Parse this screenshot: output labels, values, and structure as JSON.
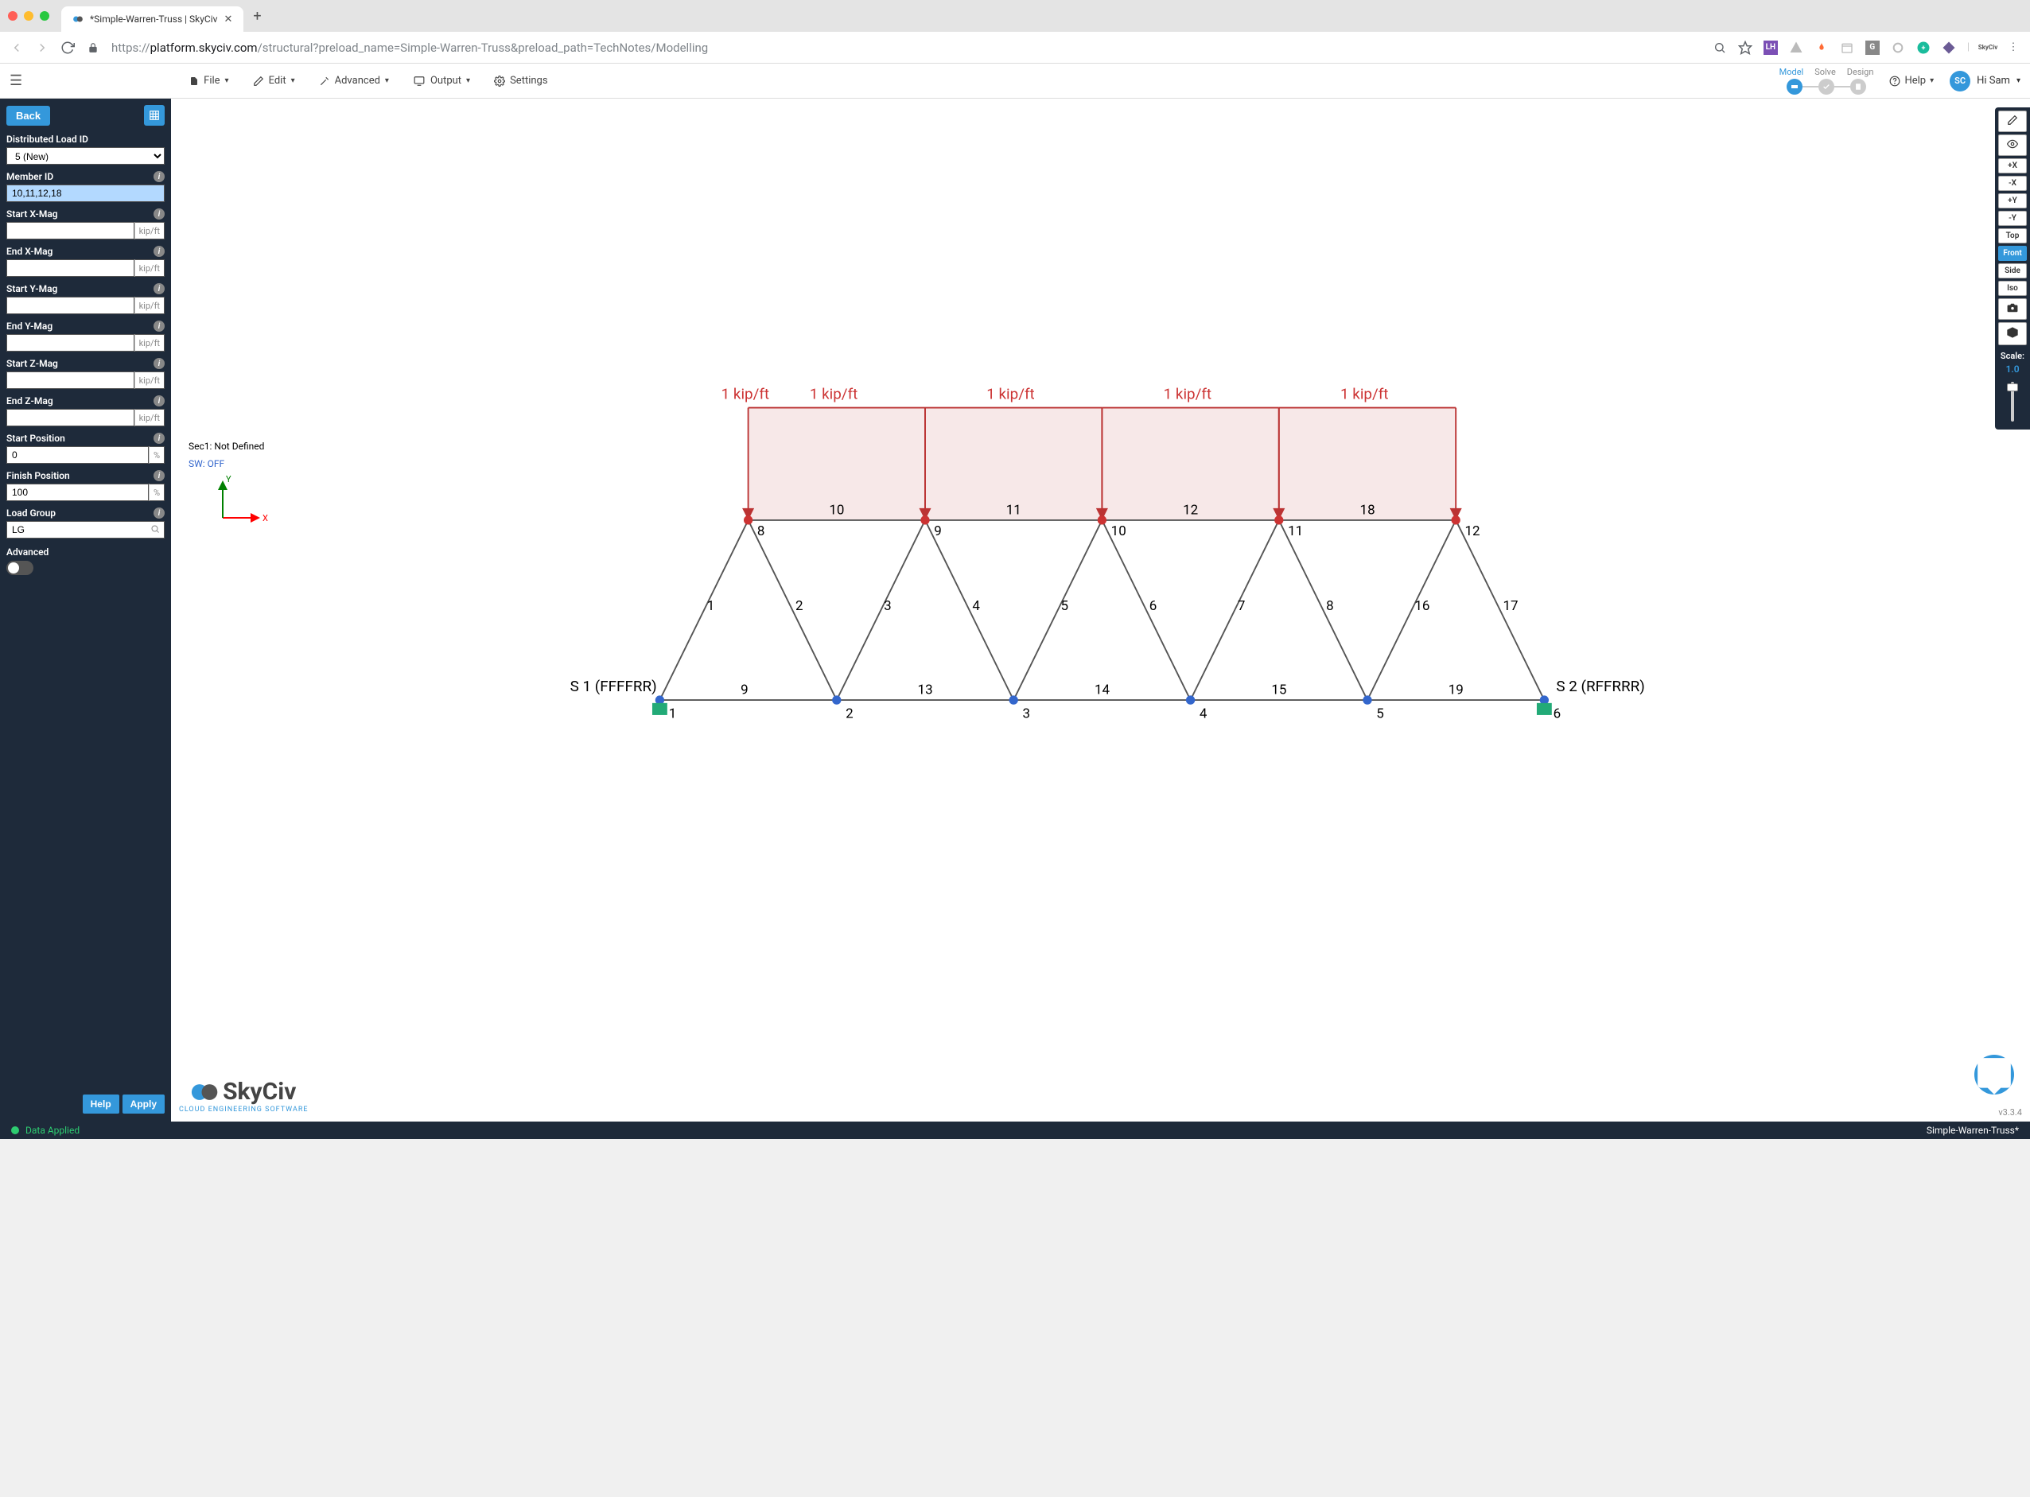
{
  "browser": {
    "tab_title": "*Simple-Warren-Truss | SkyCiv",
    "url_prefix": "https://",
    "url_host": "platform.skyciv.com",
    "url_path": "/structural?preload_name=Simple-Warren-Truss&preload_path=TechNotes/Modelling",
    "ext_lh": "LH",
    "ext_g": "G",
    "ext_skyciv": "SkyCiv"
  },
  "toolbar": {
    "file": "File",
    "edit": "Edit",
    "advanced": "Advanced",
    "output": "Output",
    "settings": "Settings",
    "workflow": {
      "model": "Model",
      "solve": "Solve",
      "design": "Design"
    },
    "help": "Help",
    "user_initials": "SC",
    "user_greeting": "Hi Sam"
  },
  "sidebar": {
    "back": "Back",
    "dl_id_label": "Distributed Load ID",
    "dl_id_value": "5 (New)",
    "member_id_label": "Member ID",
    "member_id_value": "10,11,12,18",
    "start_x_mag_label": "Start X-Mag",
    "start_x_mag_value": "",
    "end_x_mag_label": "End X-Mag",
    "end_x_mag_value": "",
    "start_y_mag_label": "Start Y-Mag",
    "start_y_mag_value": "",
    "end_y_mag_label": "End Y-Mag",
    "end_y_mag_value": "",
    "start_z_mag_label": "Start Z-Mag",
    "start_z_mag_value": "",
    "end_z_mag_label": "End Z-Mag",
    "end_z_mag_value": "",
    "unit_mag": "kip/ft",
    "start_pos_label": "Start Position",
    "start_pos_value": "0",
    "finish_pos_label": "Finish Position",
    "finish_pos_value": "100",
    "unit_pct": "%",
    "load_group_label": "Load Group",
    "load_group_value": "LG",
    "advanced_label": "Advanced",
    "help_btn": "Help",
    "apply_btn": "Apply"
  },
  "canvas": {
    "sec_text": "Sec1: Not Defined",
    "sw_text": "SW: OFF",
    "load_label": "1 kip/ft",
    "upper_members": [
      "10",
      "11",
      "12",
      "18"
    ],
    "upper_nodes": [
      "8",
      "9",
      "10",
      "11",
      "12"
    ],
    "lower_members": [
      "9",
      "13",
      "14",
      "15",
      "19"
    ],
    "lower_nodes": [
      "1",
      "2",
      "3",
      "4",
      "5",
      "6"
    ],
    "diag_members": [
      "1",
      "2",
      "3",
      "4",
      "5",
      "6",
      "7",
      "8",
      "16",
      "17"
    ],
    "support_left": "S 1 (FFFFRR)",
    "support_right": "S 2 (RFFRRR)",
    "axis_x": "X",
    "axis_y": "Y",
    "logo": "SkyCiv",
    "logo_sub": "CLOUD ENGINEERING SOFTWARE",
    "version": "v3.3.4"
  },
  "view_tools": {
    "plus_x": "+X",
    "minus_x": "-X",
    "plus_y": "+Y",
    "minus_y": "-Y",
    "top": "Top",
    "front": "Front",
    "side": "Side",
    "iso": "Iso",
    "scale_label": "Scale:",
    "scale_value": "1.0"
  },
  "status": {
    "message": "Data Applied",
    "filename": "Simple-Warren-Truss*"
  }
}
